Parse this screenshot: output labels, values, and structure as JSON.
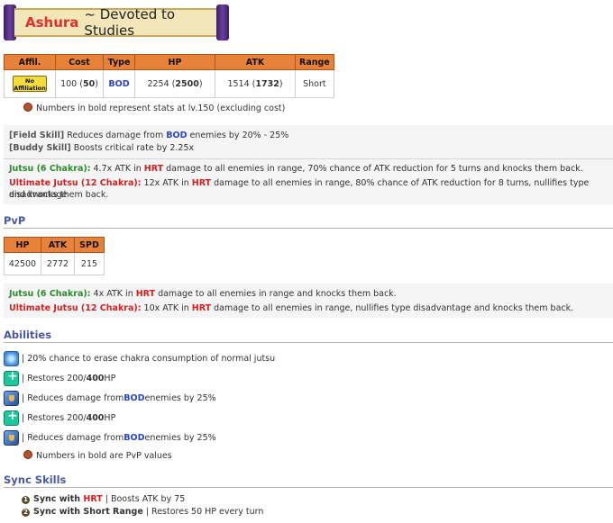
{
  "header": {
    "name": "Ashura",
    "subtitle": "~ Devoted to Studies"
  },
  "stats_table": {
    "headers": [
      "Affil.",
      "Cost",
      "Type",
      "HP",
      "ATK",
      "Range"
    ],
    "affil_line1": "No",
    "affil_line2": "Affiliation",
    "cost_base": "100 (",
    "cost_max": "50",
    "cost_end": ")",
    "type": "BOD",
    "hp_base": "2254 (",
    "hp_max": "2500",
    "hp_end": ")",
    "atk_base": "1514 (",
    "atk_max": "1732",
    "atk_end": ")",
    "range": "Short"
  },
  "note_stats": "Numbers in bold represent stats at lv.150 (excluding cost)",
  "skills": {
    "field_label": "[Field Skill]",
    "field_pre": " Reduces damage from ",
    "field_type": "BOD",
    "field_post": " enemies by 20% - 25%",
    "buddy_label": "[Buddy Skill]",
    "buddy_text": " Boosts critical rate by 2.25x"
  },
  "jutsu": {
    "label": "Jutsu (6 Chakra):",
    "pre": " 4.7x ATK in ",
    "type": "HRT",
    "post": " damage to all enemies in range, 70% chance of ATK reduction for 5 turns and knocks them back."
  },
  "ult": {
    "label": "Ultimate Jutsu (12 Chakra):",
    "pre": " 12x ATK in ",
    "type": "HRT",
    "post": " damage to all enemies in range, 80% chance of ATK reduction for 8 turns, nullifies type disadvantage",
    "post2": "and knocks them back."
  },
  "pvp": {
    "title": "PvP",
    "headers": [
      "HP",
      "ATK",
      "SPD"
    ],
    "values": [
      "42500",
      "2772",
      "215"
    ],
    "jutsu_label": "Jutsu (6 Chakra):",
    "jutsu_pre": " 4x ATK in ",
    "jutsu_type": "HRT",
    "jutsu_post": " damage to all enemies in range and knocks them back.",
    "ult_label": "Ultimate Jutsu (12 Chakra):",
    "ult_pre": " 10x ATK in ",
    "ult_type": "HRT",
    "ult_post": " damage to all enemies in range, nullifies type disadvantage and knocks them back."
  },
  "abilities": {
    "title": "Abilities",
    "items": [
      {
        "icon": "chakra-icon",
        "pre": "| 20% chance to erase chakra consumption of normal jutsu"
      },
      {
        "icon": "heal-icon",
        "pre": "| Restores 200/",
        "bold": "400",
        "post": " HP"
      },
      {
        "icon": "shield-icon",
        "pre": "| Reduces damage from ",
        "type": "BOD",
        "post": " enemies by 25%"
      },
      {
        "icon": "heal-icon",
        "pre": "| Restores 200/",
        "bold": "400",
        "post": " HP"
      },
      {
        "icon": "shield-icon",
        "pre": "| Reduces damage from ",
        "type": "BOD",
        "post": " enemies by 25%"
      }
    ],
    "note": "Numbers in bold are PvP values"
  },
  "sync": {
    "title": "Sync Skills",
    "items": [
      {
        "num": "1",
        "label_pre": "Sync with ",
        "label_type": "HRT",
        "text": " | Boosts ATK by 75"
      },
      {
        "num": "2",
        "label_pre": "Sync with Short Range",
        "text": " | Restores 50 HP every turn"
      }
    ]
  }
}
